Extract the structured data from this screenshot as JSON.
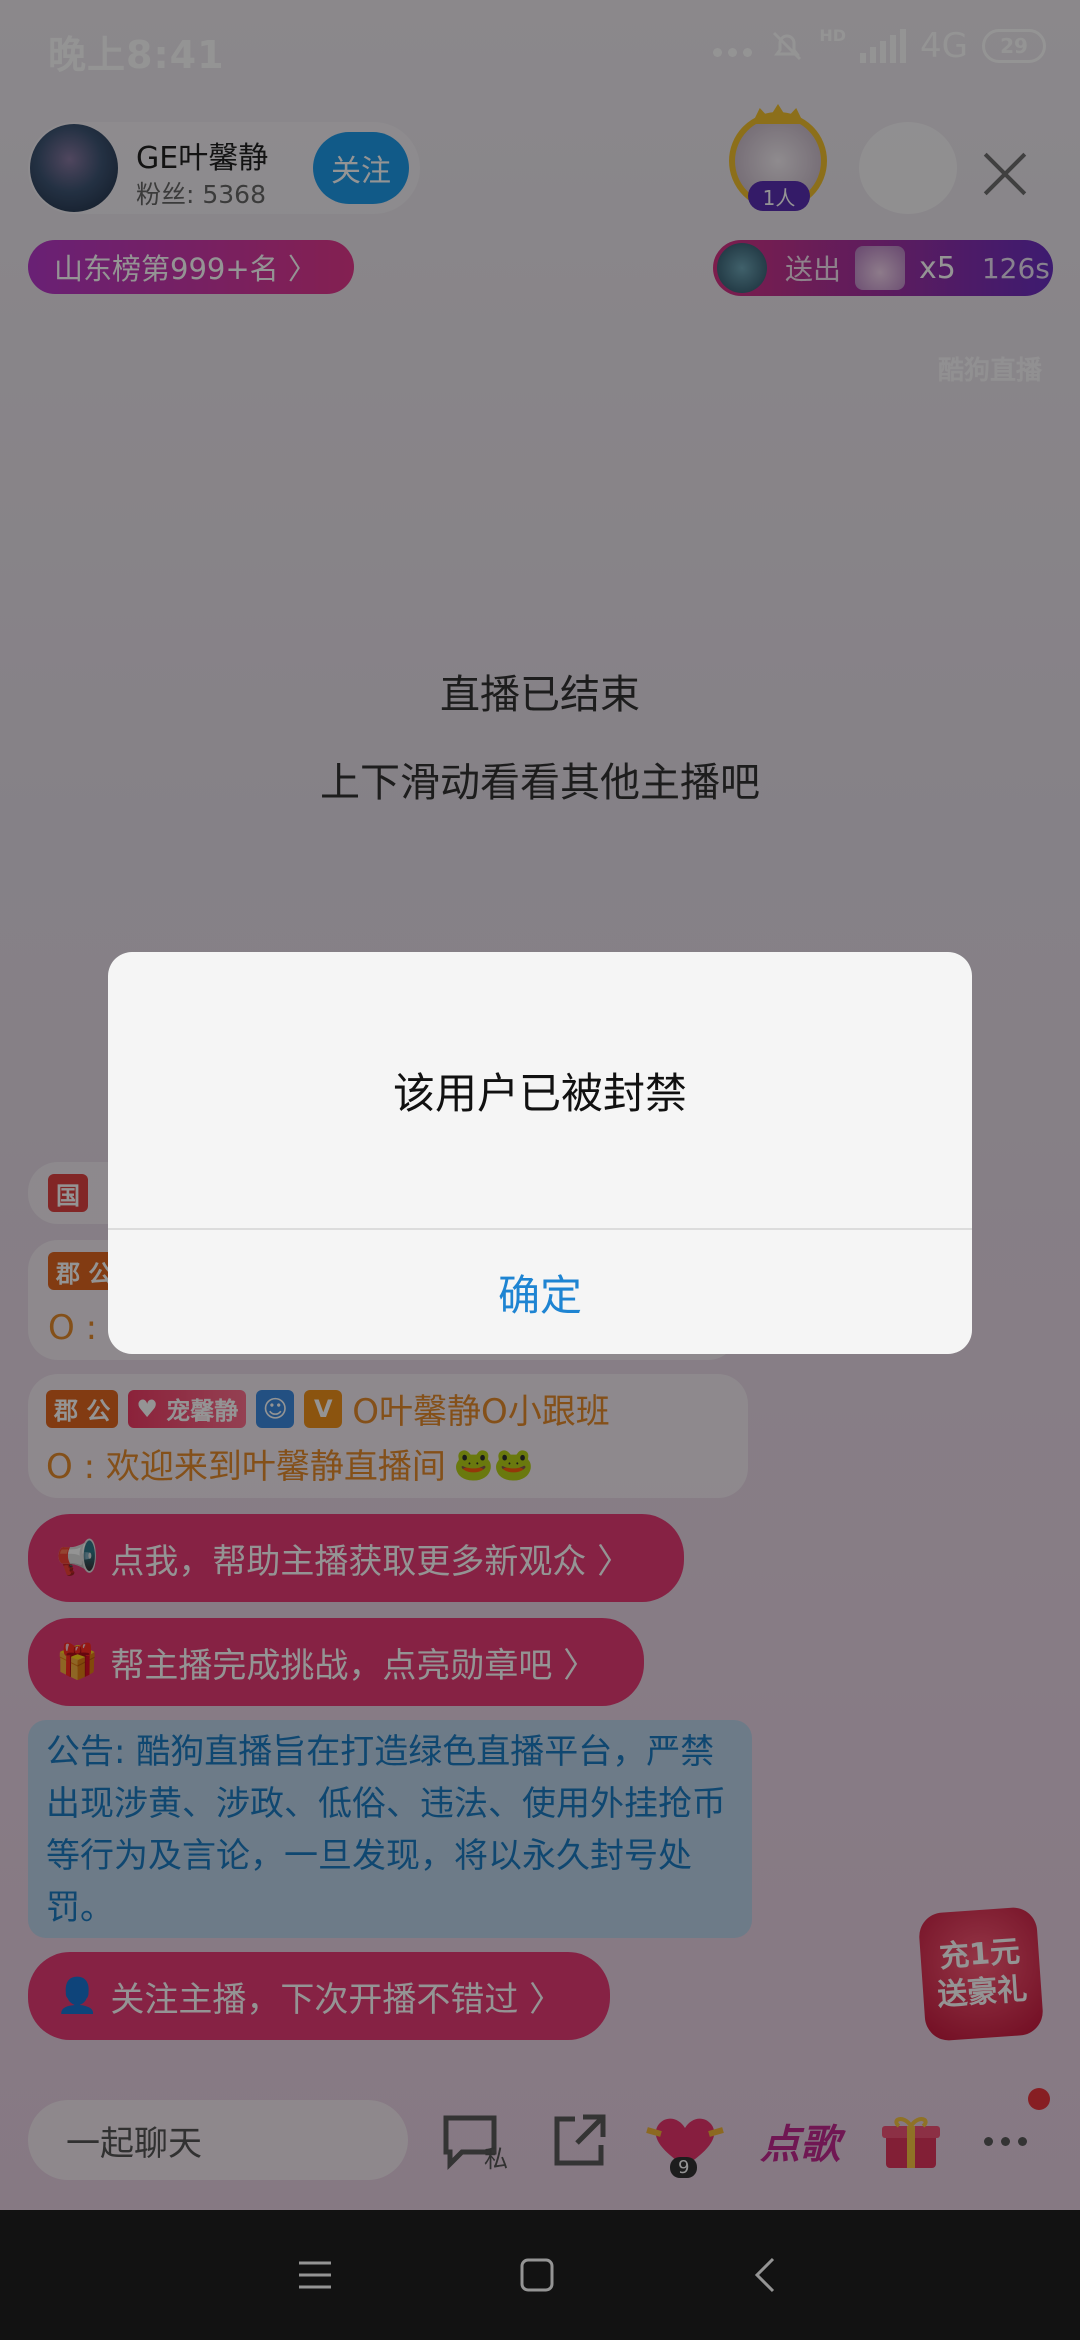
{
  "status_bar": {
    "time": "晚上8:41",
    "network": "4G",
    "battery": "29",
    "hd": "HD"
  },
  "host": {
    "name": "GE叶馨静",
    "fans": "粉丝: 5368",
    "follow_label": "关注"
  },
  "viewers": {
    "count": "1人"
  },
  "rank": {
    "label": "山东榜第999+名 〉"
  },
  "gift_banner": {
    "send_label": "送出",
    "multiplier": "x5",
    "seconds": "126s"
  },
  "watermark": "酷狗直播",
  "live_ended": {
    "line1": "直播已结束",
    "line2": "上下滑动看看其他主播吧"
  },
  "chat": {
    "row1_badge": "国",
    "row2_badge": "郡 公",
    "row2_text": "O :",
    "row3_badge": "郡 公",
    "row3_pet_badge": "宠馨静",
    "row3_v": "V",
    "row3_name": "O叶馨静O小跟班",
    "row3_msg": "O : 欢迎来到叶馨静直播间",
    "promo1": "点我，帮助主播获取更多新观众 〉",
    "promo2": "帮主播完成挑战，点亮勋章吧 〉",
    "notice": "公告: 酷狗直播旨在打造绿色直播平台，严禁出现涉黄、涉政、低俗、违法、使用外挂抢币等行为及言论，一旦发现，将以永久封号处罚。",
    "follow_promo": "关注主播，下次开播不错过 〉"
  },
  "promo_badge": {
    "line1": "充1元",
    "line2": "送豪礼"
  },
  "bottom_bar": {
    "input_placeholder": "一起聊天",
    "private_label": "私",
    "heart_count": "9",
    "song_label": "点歌"
  },
  "dialog": {
    "message": "该用户已被封禁",
    "confirm_label": "确定"
  },
  "colors": {
    "accent": "#1e84d2",
    "pink": "#e62f6c",
    "follow": "#1e9bea"
  }
}
